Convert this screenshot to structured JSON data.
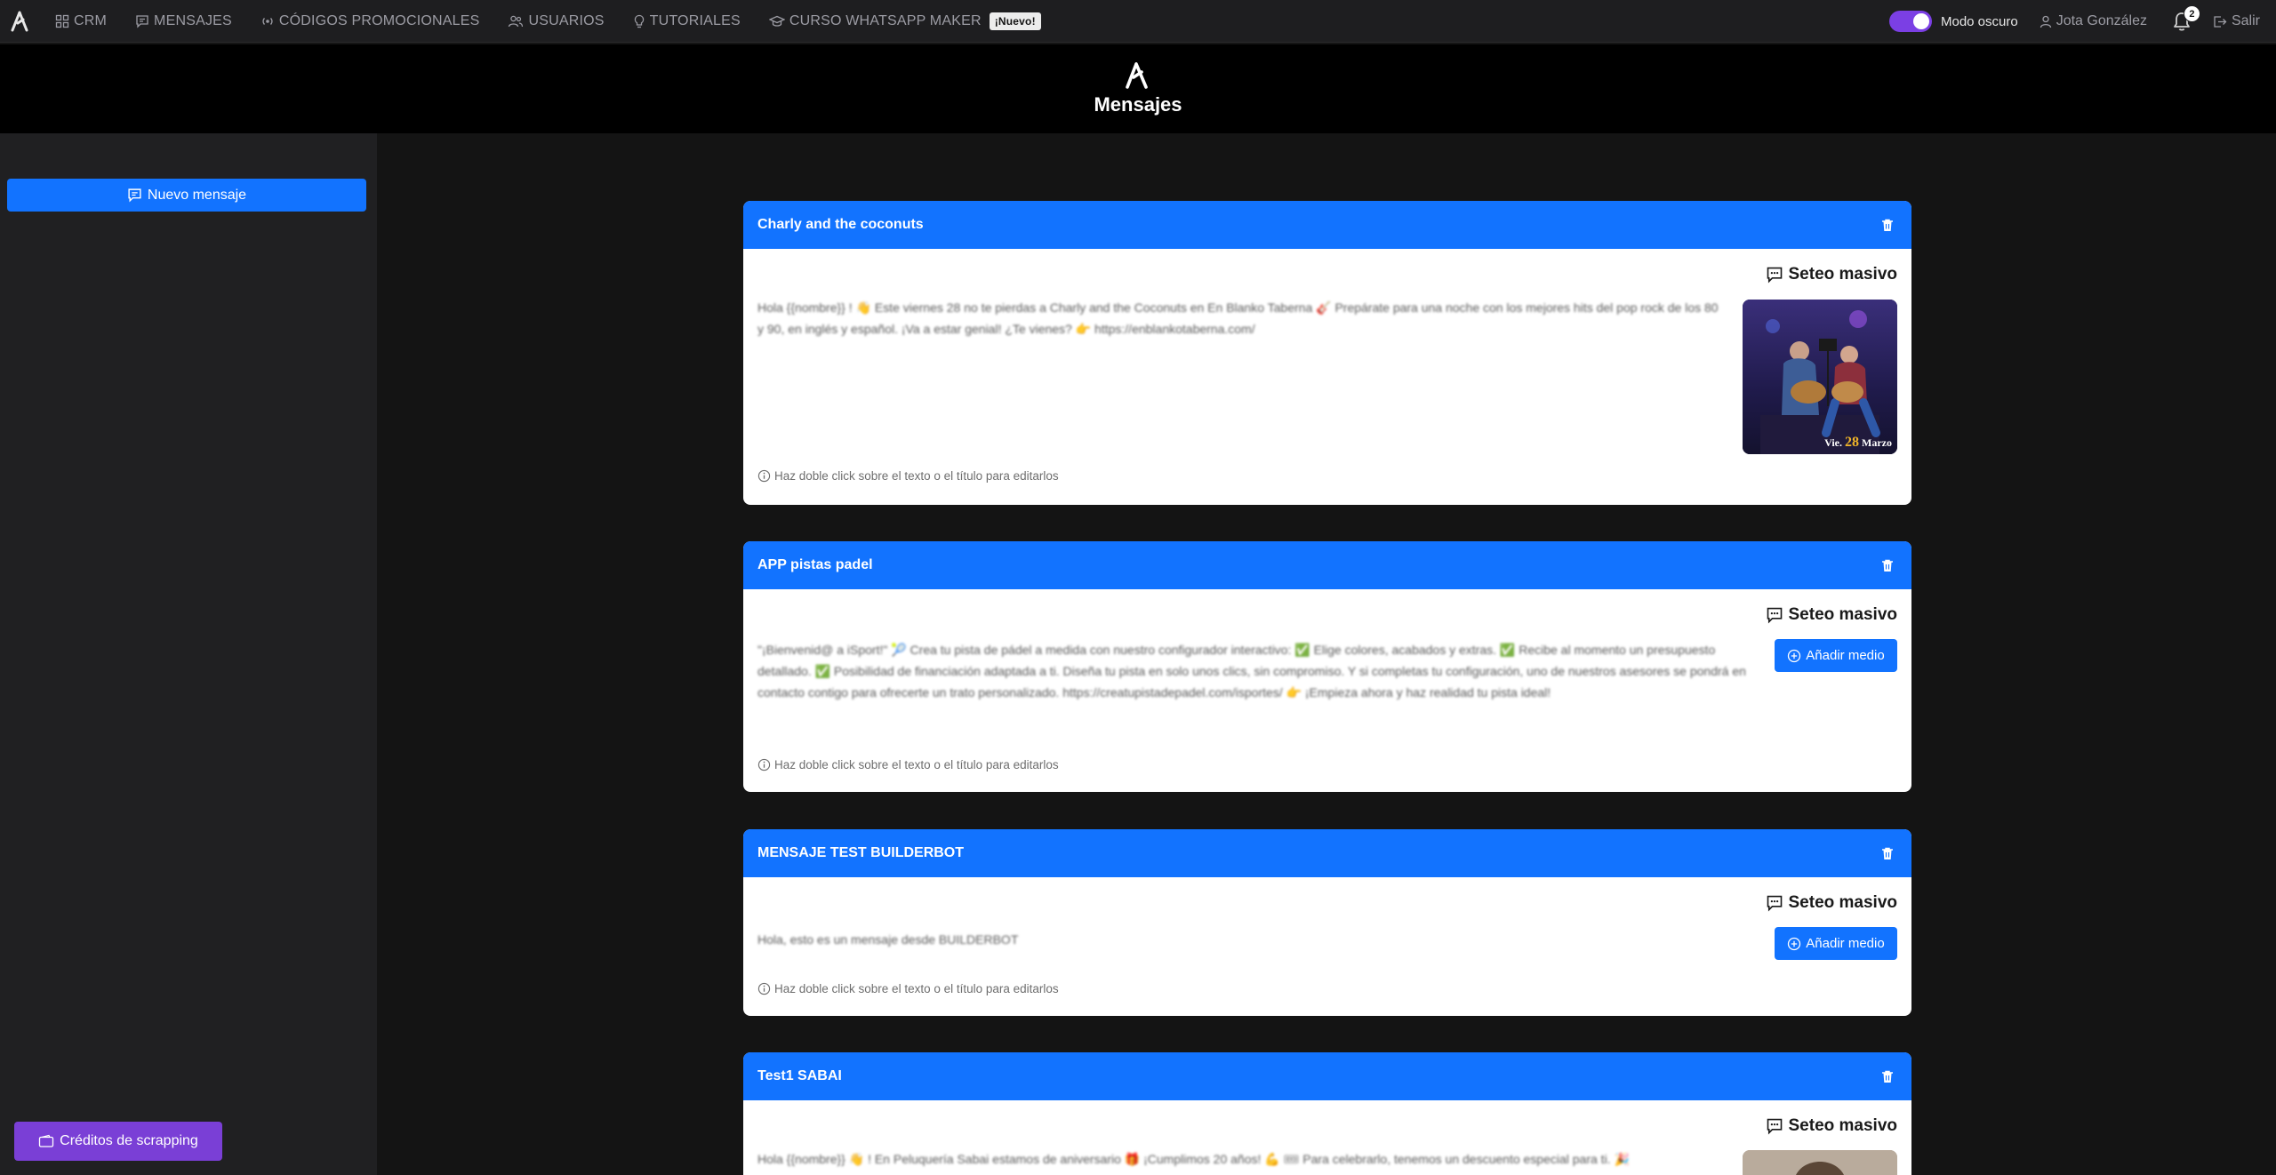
{
  "nav": {
    "items": [
      {
        "label": "CRM",
        "icon": "grid-icon"
      },
      {
        "label": "MENSAJES",
        "icon": "message-icon"
      },
      {
        "label": "CÓDIGOS PROMOCIONALES",
        "icon": "broadcast-icon"
      },
      {
        "label": "USUARIOS",
        "icon": "users-icon"
      },
      {
        "label": "TUTORIALES",
        "icon": "lightbulb-icon"
      },
      {
        "label": "CURSO WHATSAPP MAKER",
        "icon": "graduation-cap-icon"
      }
    ],
    "new_badge": "¡Nuevo!",
    "dark_mode_label": "Modo oscuro",
    "dark_mode_on": true,
    "user_name": "Jota González",
    "notifications_count": "2",
    "logout_label": "Salir"
  },
  "header": {
    "title": "Mensajes"
  },
  "sidebar": {
    "new_message_label": "Nuevo mensaje",
    "credits_label": "Créditos de scrapping"
  },
  "colors": {
    "accent": "#1273ff",
    "purple": "#7a3fd6",
    "background": "#141414",
    "sidebar": "#202022"
  },
  "messages": [
    {
      "title": "Charly and the coconuts",
      "mode": "Seteo masivo",
      "text": "Hola {{nombre}} ! 👋 Este viernes 28 no te pierdas a Charly and the Coconuts en En Blanko Taberna 🎸 Prepárate para una noche con los mejores hits del pop rock de los 80 y 90, en inglés y español. ¡Va a estar genial! ¿Te vienes? 👉 https://enblankotaberna.com/",
      "hint": "Haz doble click sobre el texto o el título para editarlos",
      "image_date_prefix": "Vie.",
      "image_date_day": "28",
      "image_date_month": "Marzo"
    },
    {
      "title": "APP pistas padel",
      "mode": "Seteo masivo",
      "text": "\"¡Bienvenid@ a iSport!\" 🎾 Crea tu pista de pádel a medida con nuestro configurador interactivo: ✅ Elige colores, acabados y extras. ✅ Recibe al momento un presupuesto detallado. ✅ Posibilidad de financiación adaptada a ti. Diseña tu pista en solo unos clics, sin compromiso. Y si completas tu configuración, uno de nuestros asesores se pondrá en contacto contigo para ofrecerte un trato personalizado. https://creatupistadepadel.com/isportes/ 👉 ¡Empieza ahora y haz realidad tu pista ideal!",
      "hint": "Haz doble click sobre el texto o el título para editarlos",
      "add_media_label": "Añadir medio"
    },
    {
      "title": "MENSAJE TEST BUILDERBOT",
      "mode": "Seteo masivo",
      "text": "Hola, esto es un mensaje desde BUILDERBOT",
      "hint": "Haz doble click sobre el texto o el título para editarlos",
      "add_media_label": "Añadir medio"
    },
    {
      "title": "Test1 SABAI",
      "mode": "Seteo masivo",
      "text": "Hola {{nombre}} 👋 ! En Peluquería Sabai estamos de aniversario 🎁 ¡Cumplimos 20 años! 💪 🎟 Para celebrarlo, tenemos un descuento especial para ti. 🎉"
    }
  ]
}
